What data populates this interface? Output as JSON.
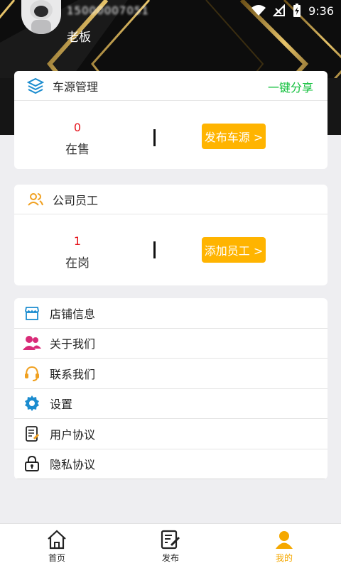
{
  "status_bar": {
    "phone_blurred": "15000007051",
    "time": "9:36"
  },
  "header": {
    "role": "老板"
  },
  "vehicle_card": {
    "title": "车源管理",
    "share_label": "一键分享",
    "count": "0",
    "count_label": "在售",
    "action_label": "发布车源 >"
  },
  "staff_card": {
    "title": "公司员工",
    "count": "1",
    "count_label": "在岗",
    "action_label": "添加员工 >"
  },
  "menu": {
    "items": [
      {
        "label": "店铺信息",
        "icon": "shop-icon"
      },
      {
        "label": "关于我们",
        "icon": "people-icon"
      },
      {
        "label": "联系我们",
        "icon": "headset-icon"
      },
      {
        "label": "设置",
        "icon": "gear-icon"
      },
      {
        "label": "用户协议",
        "icon": "document-icon"
      },
      {
        "label": "隐私协议",
        "icon": "lock-icon"
      }
    ]
  },
  "bottom_nav": {
    "items": [
      {
        "label": "首页",
        "icon": "home-icon"
      },
      {
        "label": "发布",
        "icon": "edit-icon"
      },
      {
        "label": "我的",
        "icon": "user-icon",
        "active": true
      }
    ]
  },
  "colors": {
    "accent": "#ffb400",
    "share": "#0fbf3a",
    "count": "#e5121a",
    "active_nav": "#f5a800"
  }
}
